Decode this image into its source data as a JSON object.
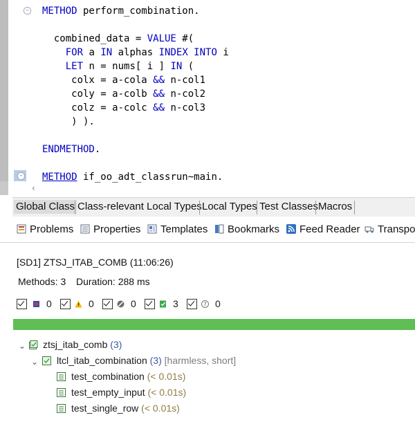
{
  "editor": {
    "lines": [
      {
        "parts": [
          [
            "kw",
            "METHOD"
          ],
          [
            "",
            " perform_combination."
          ]
        ]
      },
      {
        "parts": [
          [
            "",
            "  combined_data = "
          ],
          [
            "kw",
            "VALUE"
          ],
          [
            "",
            " #("
          ]
        ]
      },
      {
        "parts": [
          [
            "",
            "    "
          ],
          [
            "kw",
            "FOR"
          ],
          [
            "",
            " a "
          ],
          [
            "kw",
            "IN"
          ],
          [
            "",
            " alphas "
          ],
          [
            "kw",
            "INDEX INTO"
          ],
          [
            "",
            " i"
          ]
        ]
      },
      {
        "parts": [
          [
            "",
            "    "
          ],
          [
            "kw",
            "LET"
          ],
          [
            "",
            " n = nums[ i ] "
          ],
          [
            "kw",
            "IN"
          ],
          [
            "",
            " ("
          ]
        ]
      },
      {
        "parts": [
          [
            "",
            "     colx = a-cola "
          ],
          [
            "kw",
            "&&"
          ],
          [
            "",
            " n-col1"
          ]
        ]
      },
      {
        "parts": [
          [
            "",
            "     coly = a-colb "
          ],
          [
            "kw",
            "&&"
          ],
          [
            "",
            " n-col2"
          ]
        ]
      },
      {
        "parts": [
          [
            "",
            "     colz = a-colc "
          ],
          [
            "kw",
            "&&"
          ],
          [
            "",
            " n-col3"
          ]
        ]
      },
      {
        "parts": [
          [
            "",
            "     ) )."
          ]
        ]
      },
      {
        "parts": [
          [
            "",
            ""
          ]
        ]
      },
      {
        "parts": [
          [
            "kw",
            "ENDMETHOD"
          ],
          [
            "",
            "."
          ]
        ]
      },
      {
        "parts": [
          [
            "",
            ""
          ]
        ]
      },
      {
        "parts": [
          [
            "kw",
            "METHOD"
          ],
          [
            "",
            " if_oo_adt_classrun~main."
          ]
        ]
      }
    ]
  },
  "tabs": [
    "Global Class",
    "Class-relevant Local Types",
    "Local Types",
    "Test Classes",
    "Macros"
  ],
  "views": [
    "Problems",
    "Properties",
    "Templates",
    "Bookmarks",
    "Feed Reader",
    "Transport"
  ],
  "result": {
    "title": "[SD1] ZTSJ_ITAB_COMB (11:06:26)",
    "methods_label": "Methods: 3",
    "duration_label": "Duration: 288 ms",
    "status_counts": [
      "0",
      "0",
      "0",
      "3",
      "0"
    ],
    "progress_percent": 100,
    "progress_color": "#5fbe54"
  },
  "tree": {
    "root": {
      "name": "ztsj_itab_comb",
      "count": "(3)"
    },
    "class": {
      "name": "ltcl_itab_combination",
      "count": "(3)",
      "meta": "[harmless, short]"
    },
    "methods": [
      {
        "name": "test_combination",
        "time": "(< 0.01s)"
      },
      {
        "name": "test_empty_input",
        "time": "(< 0.01s)"
      },
      {
        "name": "test_single_row",
        "time": "(< 0.01s)"
      }
    ]
  }
}
